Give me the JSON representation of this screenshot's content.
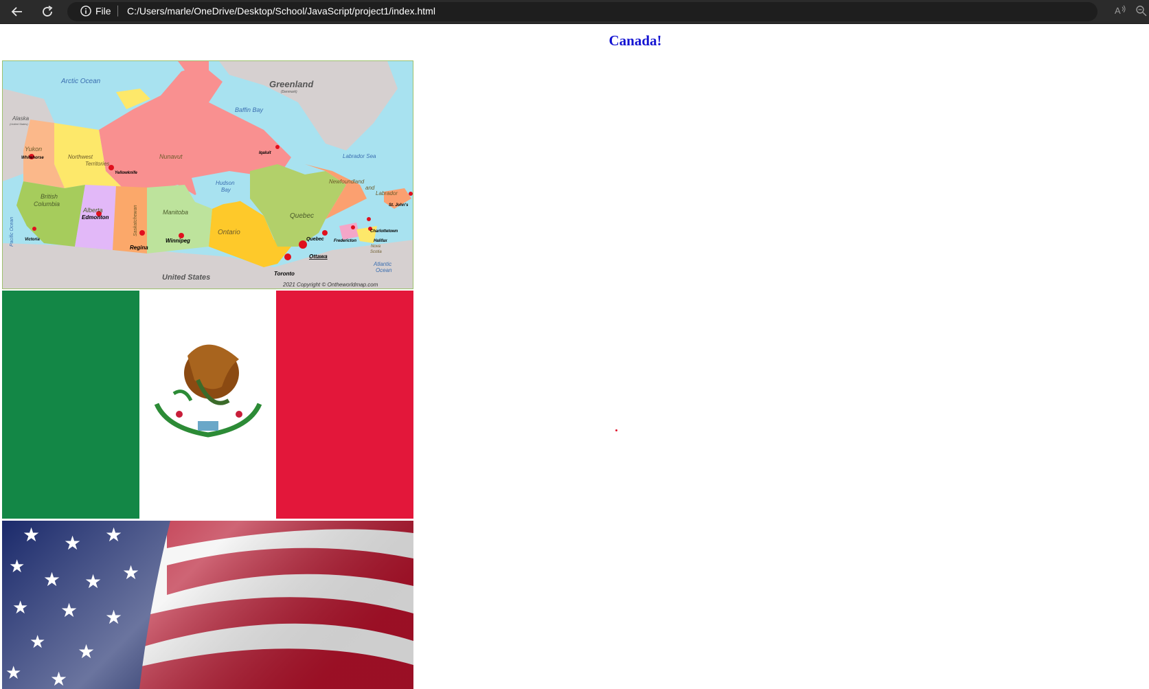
{
  "browser": {
    "file_label": "File",
    "url": "C:/Users/marle/OneDrive/Desktop/School/JavaScript/project1/index.html",
    "back_icon": "back-arrow-icon",
    "reload_icon": "reload-icon",
    "info_icon": "info-icon",
    "read_aloud_icon": "read-aloud-icon",
    "zoom_icon": "zoom-icon"
  },
  "page": {
    "heading": "Canada!",
    "heading_color": "#1414d2"
  },
  "map": {
    "labels": {
      "arctic_ocean": "Arctic Ocean",
      "greenland": "Greenland",
      "denmark": "(Denmark)",
      "baffin_bay": "Baffin Bay",
      "alaska": "Alaska",
      "united_states_small": "(United States)",
      "yukon": "Yukon",
      "whitehorse": "Whitehorse",
      "northwest": "Northwest",
      "territories": "Territories",
      "yellowknife": "Yellowknife",
      "nunavut": "Nunavut",
      "iqaluit": "Iqaluit",
      "labrador_sea": "Labrador Sea",
      "hudson": "Hudson",
      "bay": "Bay",
      "newfoundland": "Newfoundland",
      "and": "and",
      "labrador": "Labrador",
      "st_johns": "St. John's",
      "british": "British",
      "columbia": "Columbia",
      "alberta": "Alberta",
      "edmonton": "Edmonton",
      "saskatchewan": "Saskatchewan",
      "manitoba": "Manitoba",
      "quebec": "Quebec",
      "ontario": "Ontario",
      "pacific_ocean": "Pacific Ocean",
      "victoria": "Victoria",
      "regina": "Regina",
      "winnipeg": "Winnipeg",
      "quebec_city": "Quebec",
      "fredericton": "Fredericton",
      "charlottetown": "Charlottetown",
      "halifax": "Halifax",
      "nova": "Nova",
      "scotia": "Scotia",
      "ottawa": "Ottawa",
      "atlantic": "Atlantic",
      "ocean": "Ocean",
      "toronto": "Toronto",
      "united_states": "United States",
      "copyright": "2021 Copyright © Ontheworldmap.com"
    },
    "colors": {
      "water": "#a8e2f0",
      "land_other": "#d6d0d0",
      "nunavut": "#f99090",
      "nwt": "#fde86a",
      "yukon": "#fbb88a",
      "bc": "#a6cc5c",
      "alberta": "#e2b8f8",
      "saskatchewan": "#fba86a",
      "manitoba": "#bde39c",
      "ontario": "#fec92a",
      "quebec": "#b2d06a",
      "nl": "#fba070",
      "capital": "#e0101e"
    }
  },
  "flags": {
    "mexico": {
      "green": "#138746",
      "white": "#ffffff",
      "red": "#e3173a"
    },
    "usa": {
      "blue": "#1b2a6b",
      "red": "#b5122b",
      "white": "#f2f2f2"
    }
  }
}
